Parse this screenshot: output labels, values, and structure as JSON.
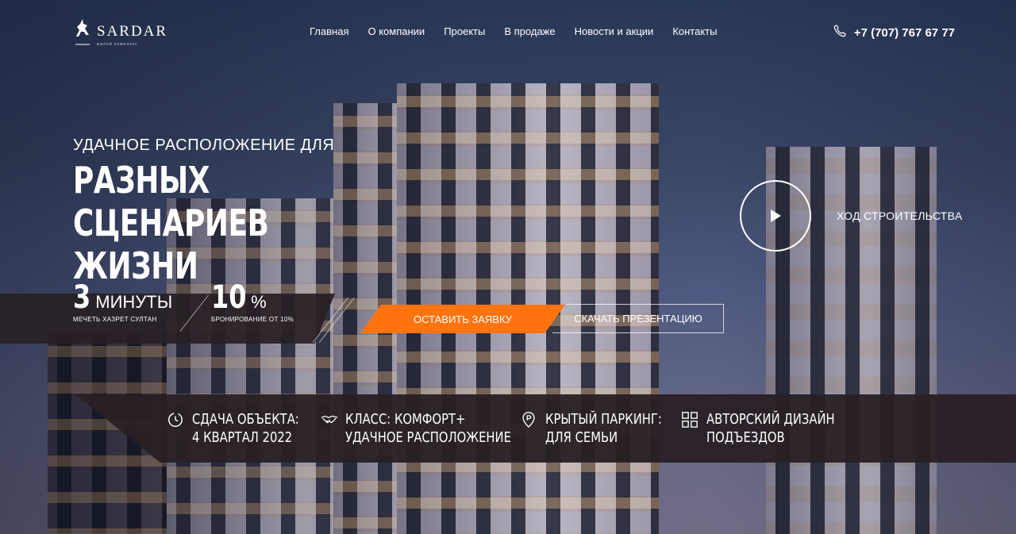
{
  "header": {
    "logo_text": "SARDAR",
    "logo_sub": "жилой комплекс",
    "nav": [
      "Главная",
      "О компании",
      "Проекты",
      "В продаже",
      "Новости и акции",
      "Контакты"
    ],
    "phone": "+7 (707) 767 67 77"
  },
  "hero": {
    "subtitle": "УДАЧНОЕ РАСПОЛОЖЕНИЕ ДЛЯ",
    "title": "РАЗНЫХ СЦЕНАРИЕВ ЖИЗНИ"
  },
  "stats": [
    {
      "value": "3",
      "unit": "МИНУТЫ",
      "caption": "МЕЧЕТЬ ХАЗРЕТ СУЛТАН"
    },
    {
      "value": "10",
      "unit": "%",
      "caption": "БРОНИРОВАНИЕ ОТ 10%"
    }
  ],
  "buttons": {
    "order": "ОСТАВИТЬ ЗАЯВКУ",
    "presentation": "СКАЧАТЬ ПРЕЗЕНТАЦИЮ"
  },
  "video": {
    "label": "ХОД СТРОИТЕЛЬСТВА"
  },
  "features": [
    {
      "icon": "clock-icon",
      "line1": "СДАЧА ОБЪЕКТА:",
      "line2": "4 КВАРТАЛ 2022"
    },
    {
      "icon": "handshake-icon",
      "line1": "КЛАСС: КОМФОРТ+",
      "line2": "УДАЧНОЕ РАСПОЛОЖЕНИЕ"
    },
    {
      "icon": "parking-icon",
      "line1": "КРЫТЫЙ ПАРКИНГ:",
      "line2": "ДЛЯ СЕМЬИ"
    },
    {
      "icon": "grid-icon",
      "line1": "АВТОРСКИЙ ДИЗАЙН",
      "line2": "ПОДЪЕЗДОВ"
    }
  ],
  "colors": {
    "accent": "#ff7410",
    "band": "#2a2024"
  }
}
